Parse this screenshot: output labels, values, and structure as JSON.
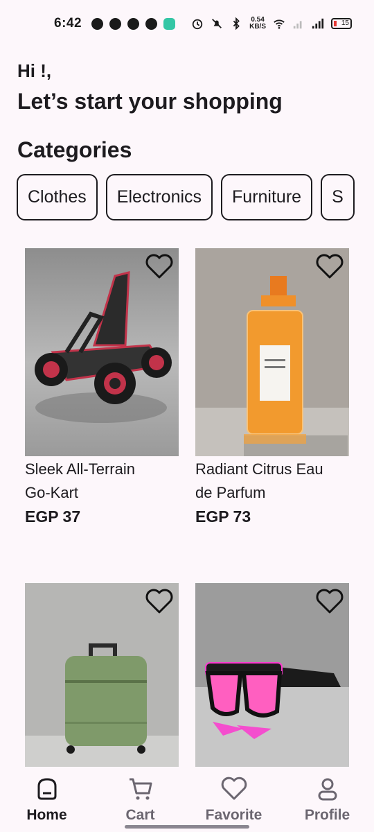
{
  "status_bar": {
    "time": "6:42",
    "net_speed_value": "0.54",
    "net_speed_unit": "KB/S",
    "battery": "15"
  },
  "greeting": {
    "hi": "Hi !,",
    "subtitle": "Let’s start your shopping"
  },
  "categories": {
    "title": "Categories",
    "items": [
      "Clothes",
      "Electronics",
      "Furniture",
      "S"
    ]
  },
  "products": [
    {
      "name_line1": "Sleek All-Terrain",
      "name_line2": "Go-Kart",
      "price": "EGP 37",
      "image": "go-kart"
    },
    {
      "name_line1": "Radiant Citrus Eau",
      "name_line2": "de Parfum",
      "price": "EGP 73",
      "image": "perfume-bottle"
    },
    {
      "name_line1": "",
      "name_line2": "",
      "price": "",
      "image": "suitcase"
    },
    {
      "name_line1": "",
      "name_line2": "",
      "price": "",
      "image": "sunglasses"
    }
  ],
  "nav": {
    "home": "Home",
    "cart": "Cart",
    "favorite": "Favorite",
    "profile": "Profile",
    "active": "home"
  },
  "colors": {
    "background": "#fdf7fb",
    "text": "#1d1b1f",
    "inactive_nav": "#6b6670"
  }
}
